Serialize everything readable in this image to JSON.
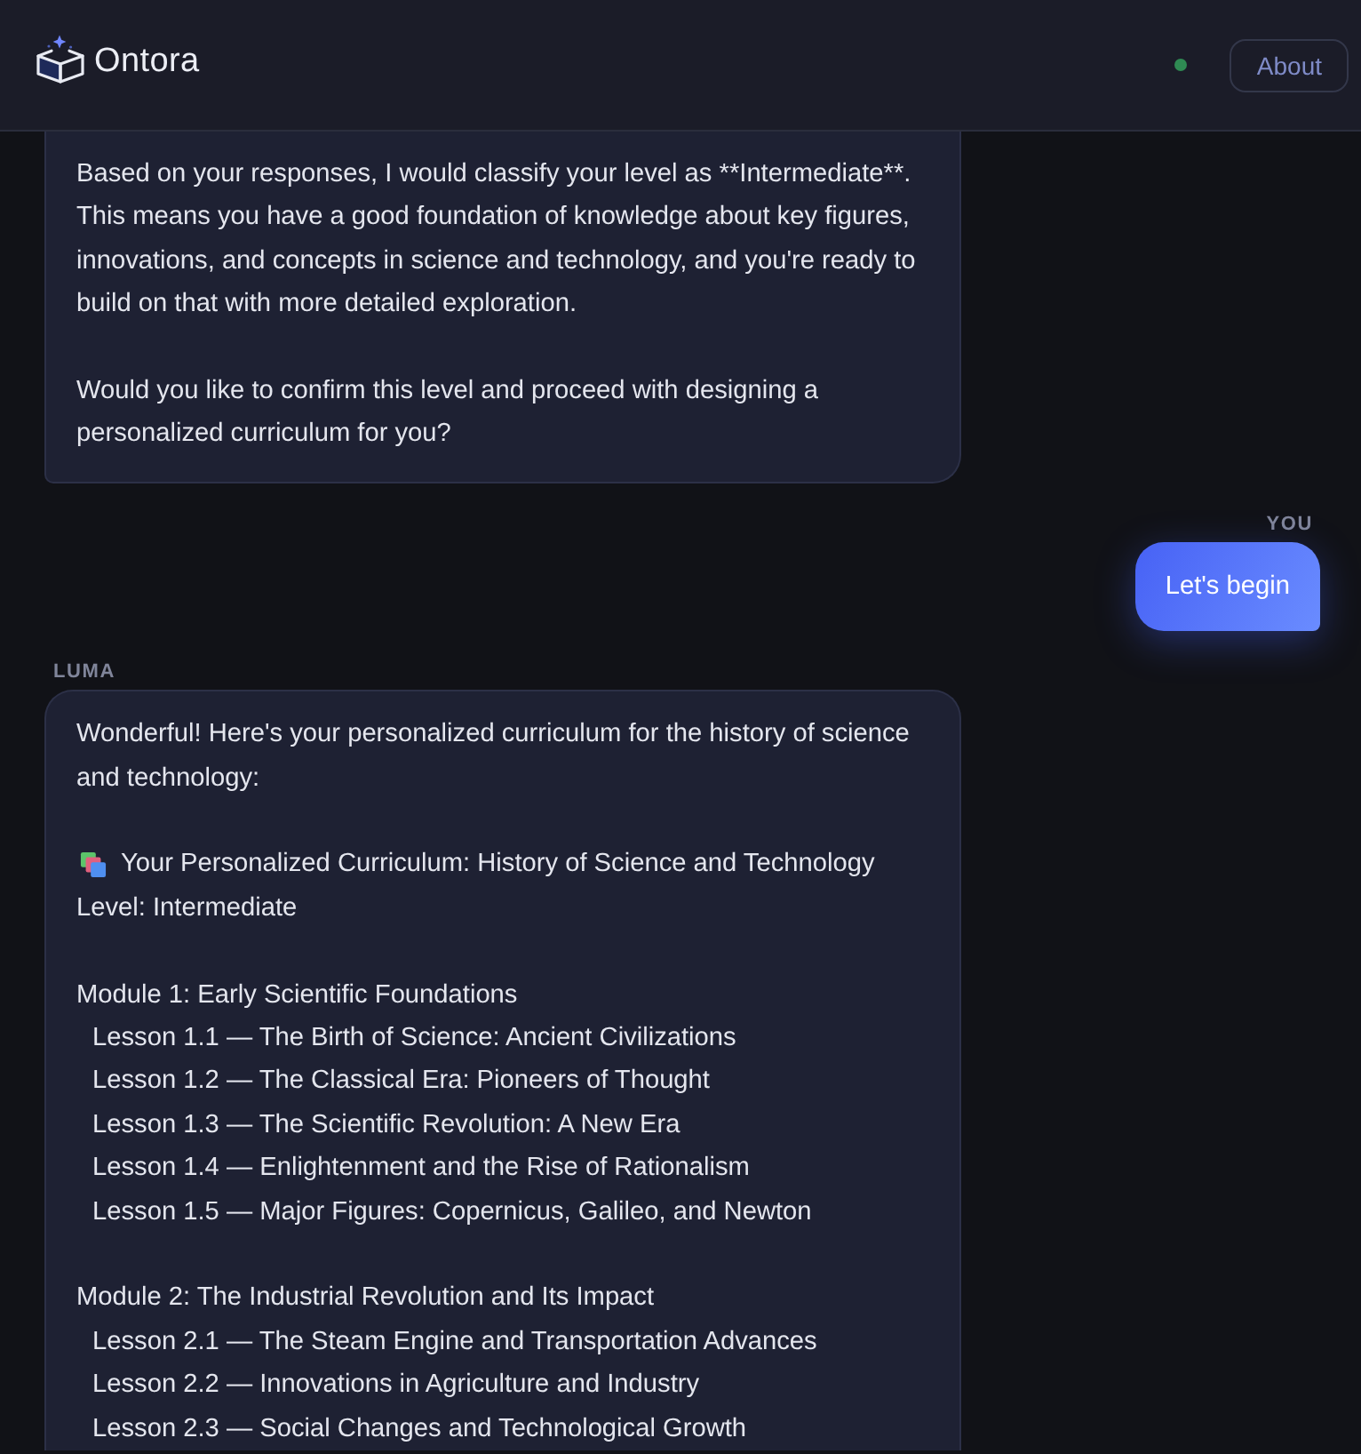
{
  "header": {
    "brand": "Ontora",
    "status": {
      "online": true
    },
    "about_button": "About"
  },
  "messages": [
    {
      "kind": "assistant",
      "sections": [
        {
          "kind": "text",
          "text": "Based on your responses, I would classify your level as **Intermediate**. This means you have a good foundation of knowledge about key figures, innovations, and concepts in science and technology, and you're ready to build on that with more detailed exploration."
        },
        {
          "kind": "text",
          "text": "Would you like to confirm this level and proceed with designing a personalized curriculum for you?"
        }
      ]
    },
    {
      "kind": "user",
      "sender": "YOU",
      "text": "Let's begin"
    },
    {
      "kind": "assistant",
      "sender": "LUMA",
      "sections": [
        {
          "kind": "text",
          "text": "Wonderful! Here's your personalized curriculum for the history of science and technology:"
        },
        {
          "kind": "title",
          "text": "Your Personalized Curriculum: History of Science and Technology",
          "subtitle": "Level: Intermediate"
        },
        {
          "kind": "module",
          "title": "Module 1: Early Scientific Foundations",
          "lessons": [
            "Lesson 1.1 — The Birth of Science: Ancient Civilizations",
            "Lesson 1.2 — The Classical Era: Pioneers of Thought",
            "Lesson 1.3 — The Scientific Revolution: A New Era",
            "Lesson 1.4 — Enlightenment and the Rise of Rationalism",
            "Lesson 1.5 — Major Figures: Copernicus, Galileo, and Newton"
          ]
        },
        {
          "kind": "module",
          "title": "Module 2: The Industrial Revolution and Its Impact",
          "lessons": [
            "Lesson 2.1 — The Steam Engine and Transportation Advances",
            "Lesson 2.2 — Innovations in Agriculture and Industry",
            "Lesson 2.3 — Social Changes and Technological Growth"
          ]
        }
      ]
    }
  ]
}
